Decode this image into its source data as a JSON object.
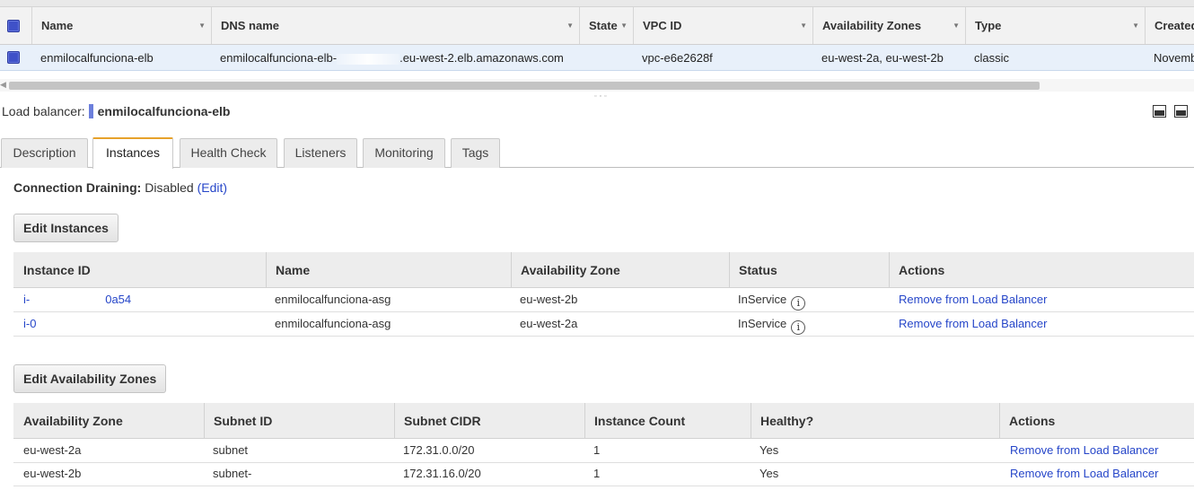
{
  "lb_table": {
    "columns": [
      {
        "label": "Name"
      },
      {
        "label": "DNS name"
      },
      {
        "label": "State"
      },
      {
        "label": "VPC ID"
      },
      {
        "label": "Availability Zones"
      },
      {
        "label": "Type"
      },
      {
        "label": "Created"
      }
    ],
    "row": {
      "name": "enmilocalfunciona-elb",
      "dns_prefix": "enmilocalfunciona-elb-",
      "dns_suffix": ".eu-west-2.elb.amazonaws.com",
      "state": "",
      "vpc_id": "vpc-e6e2628f",
      "zones": "eu-west-2a, eu-west-2b",
      "type": "classic",
      "created": "Novemb"
    }
  },
  "detail": {
    "label": "Load balancer:",
    "name": "enmilocalfunciona-elb",
    "accent_color": "#6c7fdc"
  },
  "tabs": [
    {
      "label": "Description"
    },
    {
      "label": "Instances",
      "active": true
    },
    {
      "label": "Health Check"
    },
    {
      "label": "Listeners"
    },
    {
      "label": "Monitoring"
    },
    {
      "label": "Tags"
    }
  ],
  "draining": {
    "label": "Connection Draining:",
    "value": "Disabled",
    "edit": "(Edit)"
  },
  "edit_instances_label": "Edit Instances",
  "instances": {
    "headers": [
      "Instance ID",
      "Name",
      "Availability Zone",
      "Status",
      "Actions"
    ],
    "rows": [
      {
        "id_start": "i-",
        "id_end": "0a54",
        "name": "enmilocalfunciona-asg",
        "zone": "eu-west-2b",
        "status": "InService",
        "action": "Remove from Load Balancer"
      },
      {
        "id_start": "i-0",
        "id_end": "",
        "name": "enmilocalfunciona-asg",
        "zone": "eu-west-2a",
        "status": "InService",
        "action": "Remove from Load Balancer"
      }
    ]
  },
  "edit_zones_label": "Edit Availability Zones",
  "zones": {
    "headers": [
      "Availability Zone",
      "Subnet ID",
      "Subnet CIDR",
      "Instance Count",
      "Healthy?",
      "Actions"
    ],
    "rows": [
      {
        "zone": "eu-west-2a",
        "subnet": "subnet",
        "cidr": "172.31.0.0/20",
        "count": "1",
        "healthy": "Yes",
        "action": "Remove from Load Balancer"
      },
      {
        "zone": "eu-west-2b",
        "subnet": "subnet-",
        "cidr": "172.31.16.0/20",
        "count": "1",
        "healthy": "Yes",
        "action": "Remove from Load Balancer"
      }
    ]
  },
  "colors": {
    "link": "#2646c9",
    "selected_row": "#e8f0fa",
    "active_tab_accent": "#e7a22b",
    "checkbox": "#3f51c8"
  }
}
